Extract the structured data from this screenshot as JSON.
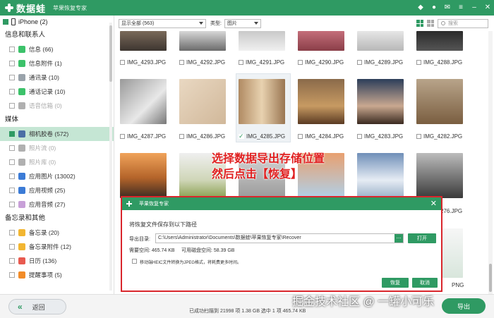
{
  "title_bar": {
    "app_name": "数据蛙",
    "subtitle": "苹果恢复专家",
    "icons": [
      "diamond-icon",
      "person-icon",
      "mail-icon",
      "menu-icon",
      "minimize-icon",
      "close-icon"
    ]
  },
  "sidebar": {
    "device": "iPhone (2)",
    "sections": [
      {
        "title": "信息和联系人",
        "items": [
          {
            "label": "信息 (66)",
            "icon": "message-icon",
            "color": "#3cc26a",
            "disabled": false
          },
          {
            "label": "信息附件 (1)",
            "icon": "attachment-icon",
            "color": "#3cc26a",
            "disabled": false
          },
          {
            "label": "通讯录 (10)",
            "icon": "contacts-icon",
            "color": "#9aa3ab",
            "disabled": false
          },
          {
            "label": "通话记录 (10)",
            "icon": "call-icon",
            "color": "#3cc26a",
            "disabled": false
          },
          {
            "label": "语音信箱 (0)",
            "icon": "voicemail-icon",
            "color": "#b0b0b0",
            "disabled": true
          }
        ]
      },
      {
        "title": "媒体",
        "items": [
          {
            "label": "相机胶卷 (572)",
            "icon": "camera-roll-icon",
            "color": "#4a6fa5",
            "disabled": false,
            "active": true
          },
          {
            "label": "照片流 (0)",
            "icon": "photo-stream-icon",
            "color": "#b0b0b0",
            "disabled": true
          },
          {
            "label": "照片库 (0)",
            "icon": "photo-library-icon",
            "color": "#b0b0b0",
            "disabled": true
          },
          {
            "label": "应用图片 (13002)",
            "icon": "app-image-icon",
            "color": "#3b7bd6",
            "disabled": false
          },
          {
            "label": "应用视频 (25)",
            "icon": "app-video-icon",
            "color": "#3b7bd6",
            "disabled": false
          },
          {
            "label": "应用音频 (27)",
            "icon": "app-audio-icon",
            "color": "#c8a0d8",
            "disabled": false
          }
        ]
      },
      {
        "title": "备忘录和其他",
        "items": [
          {
            "label": "备忘录 (20)",
            "icon": "notes-icon",
            "color": "#f2b632",
            "disabled": false
          },
          {
            "label": "备忘录附件 (12)",
            "icon": "notes-attachment-icon",
            "color": "#f2b632",
            "disabled": false
          },
          {
            "label": "日历 (136)",
            "icon": "calendar-icon",
            "color": "#e85a4f",
            "disabled": false
          },
          {
            "label": "提醒事项 (5)",
            "icon": "reminder-icon",
            "color": "#f28c28",
            "disabled": false
          }
        ]
      }
    ]
  },
  "toolbar": {
    "filter_value": "显示全部 (563)",
    "type_label": "类型:",
    "type_value": "图片",
    "search_placeholder": "搜索"
  },
  "gallery": {
    "row1": [
      "IMG_4293.JPG",
      "IMG_4292.JPG",
      "IMG_4291.JPG",
      "IMG_4290.JPG",
      "IMG_4289.JPG",
      "IMG_4288.JPG"
    ],
    "row2": [
      "IMG_4287.JPG",
      "IMG_4286.JPG",
      "IMG_4285.JPG",
      "IMG_4284.JPG",
      "IMG_4283.JPG",
      "IMG_4282.JPG"
    ],
    "row3_partial": [
      "IMG_4276.JPG"
    ],
    "row4_partial": [
      "PNG"
    ]
  },
  "annotation": {
    "line1": "选择数据导出存储位置",
    "line2": "然后点击【恢复】"
  },
  "dialog": {
    "title": "苹果恢复专家",
    "prompt": "将恢复文件保存到以下路径",
    "export_dir_label": "导出目录:",
    "path": "C:\\Users\\Administrator\\Documents\\数据蛙\\苹果恢复专家\\Recover",
    "dots_label": "...",
    "open_label": "打开",
    "required_space": "需要空间:  465.74 KB",
    "available_space": "可用磁盘空间:  58.39 GB",
    "heic_option": "移动端HEIC文件转换为JPEG格式，将耗费更多时间。",
    "recover_label": "恢复",
    "cancel_label": "取消"
  },
  "bottom": {
    "back_label": "返回",
    "status": "已成功扫描到 21998 项 1.38 GB    选中 1 项 465.74 KB",
    "export_label": "导出",
    "watermark": "掘金技术社区 @ 一罐小可乐"
  }
}
